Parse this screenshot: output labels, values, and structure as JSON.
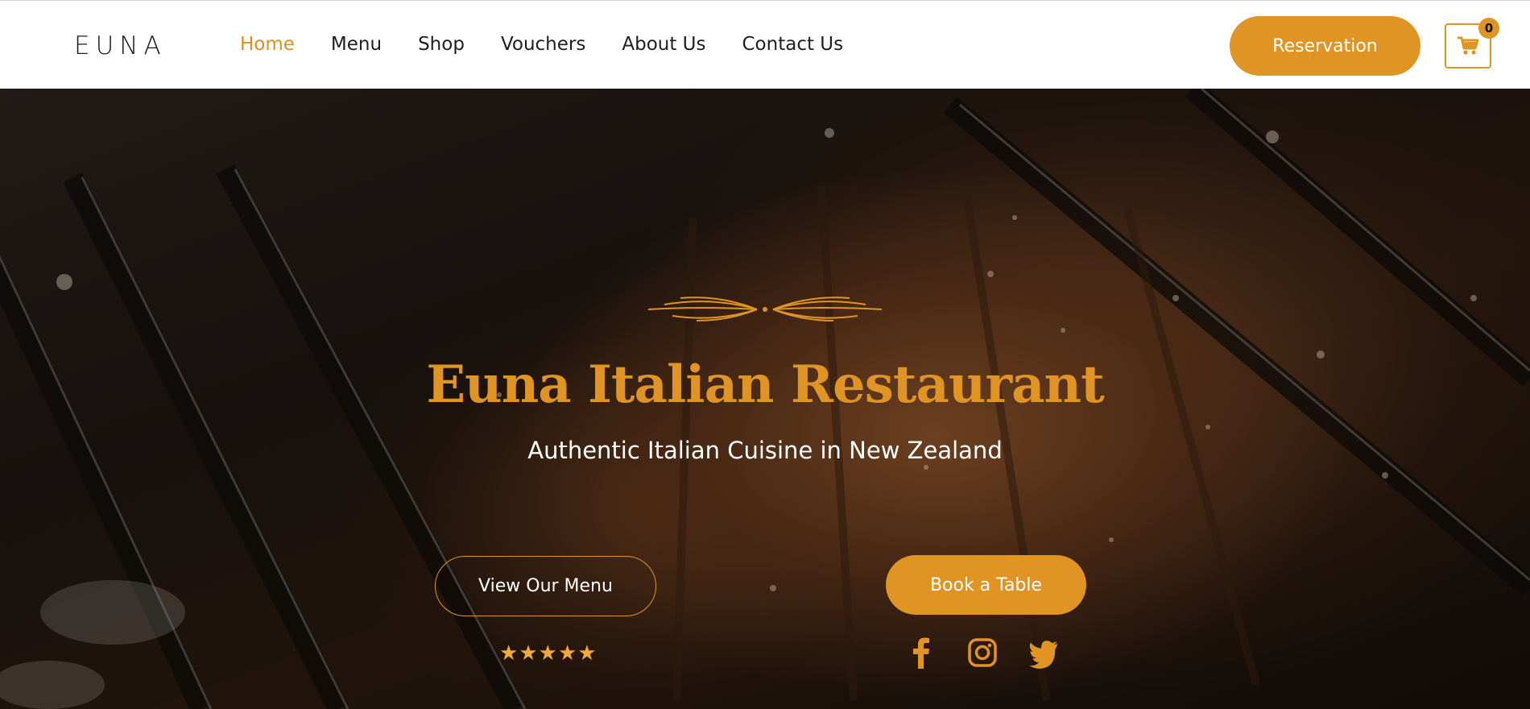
{
  "header": {
    "logo_text": "EUNA",
    "nav": [
      {
        "label": "Home",
        "active": true
      },
      {
        "label": "Menu",
        "active": false
      },
      {
        "label": "Shop",
        "active": false
      },
      {
        "label": "Vouchers",
        "active": false
      },
      {
        "label": "About Us",
        "active": false
      },
      {
        "label": "Contact Us",
        "active": false
      }
    ],
    "reservation_label": "Reservation",
    "cart_count": "0"
  },
  "hero": {
    "title": "Euna Italian Restaurant",
    "subtitle": "Authentic Italian Cuisine in New Zealand",
    "menu_button_label": "View Our Menu",
    "book_button_label": "Book a Table",
    "rating": 5,
    "socials": [
      "facebook-icon",
      "instagram-icon",
      "twitter-icon"
    ]
  },
  "colors": {
    "accent": "#df9424",
    "nav_active": "#df8e22",
    "nav_text": "#1e1e1e",
    "header_bg": "#ffffff",
    "subtitle_text": "#ffffff"
  }
}
